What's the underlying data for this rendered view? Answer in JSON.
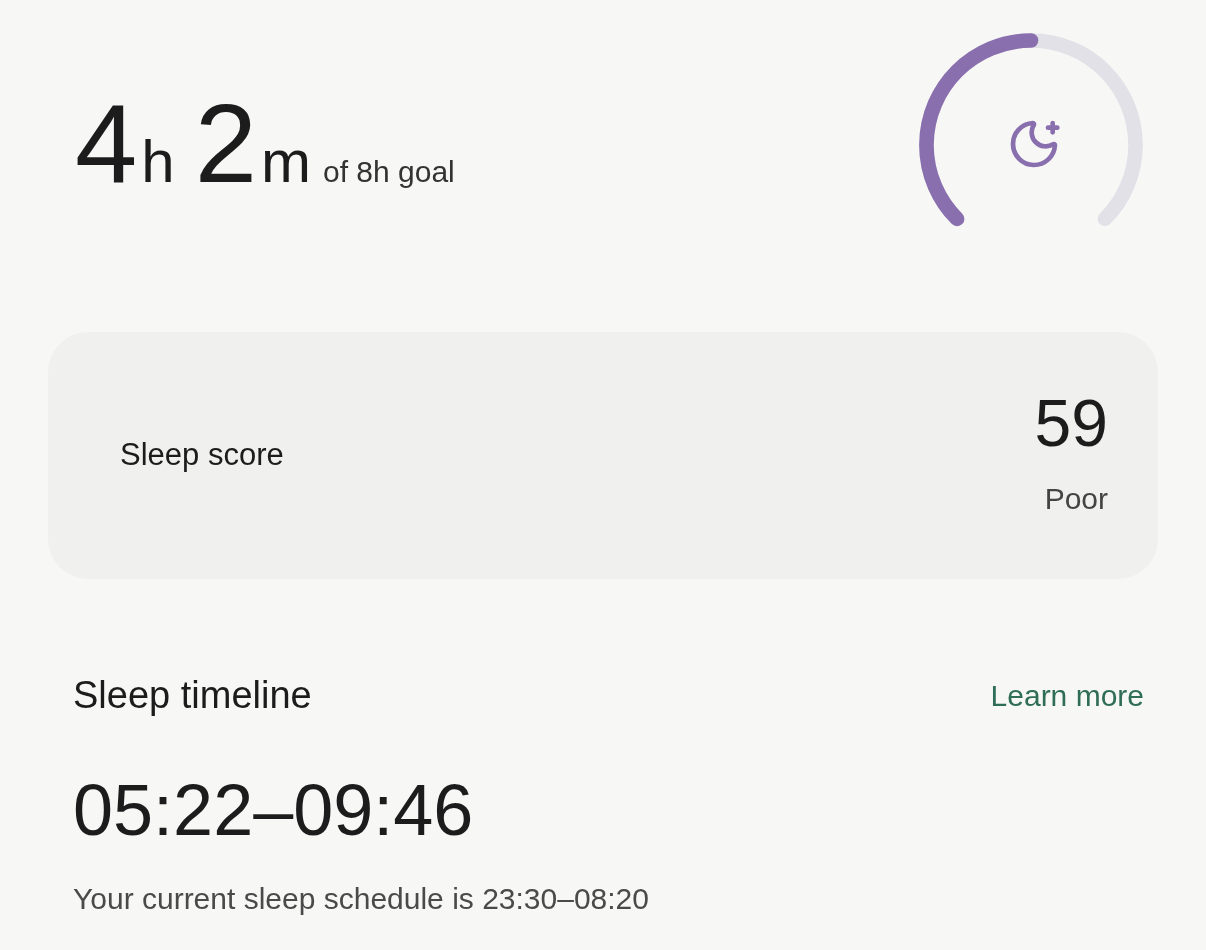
{
  "duration": {
    "hours": "4",
    "hours_unit": "h",
    "minutes": "2",
    "minutes_unit": "m",
    "goal": "of 8h goal"
  },
  "score_card": {
    "label": "Sleep score",
    "value": "59",
    "rating": "Poor"
  },
  "timeline": {
    "title": "Sleep timeline",
    "link": "Learn more",
    "range": "05:22–09:46",
    "schedule": "Your current sleep schedule is 23:30–08:20"
  }
}
